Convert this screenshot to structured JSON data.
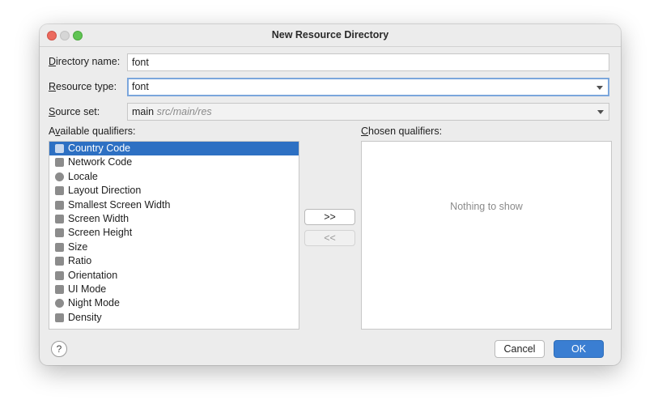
{
  "window": {
    "title": "New Resource Directory"
  },
  "form": {
    "directory_name": {
      "mnemonic": "D",
      "label_rest": "irectory name:",
      "value": "font"
    },
    "resource_type": {
      "mnemonic": "R",
      "label_rest": "esource type:",
      "value": "font"
    },
    "source_set": {
      "mnemonic": "S",
      "label_rest": "ource set:",
      "value": "main",
      "path": "src/main/res"
    }
  },
  "available": {
    "label_pre": "A",
    "mnemonic": "v",
    "label_rest": "ailable qualifiers:",
    "items": [
      {
        "label": "Country Code",
        "icon": "country-code-icon",
        "selected": true
      },
      {
        "label": "Network Code",
        "icon": "network-code-icon"
      },
      {
        "label": "Locale",
        "icon": "globe-icon"
      },
      {
        "label": "Layout Direction",
        "icon": "layout-direction-icon"
      },
      {
        "label": "Smallest Screen Width",
        "icon": "smallest-width-icon"
      },
      {
        "label": "Screen Width",
        "icon": "screen-width-icon"
      },
      {
        "label": "Screen Height",
        "icon": "screen-height-icon"
      },
      {
        "label": "Size",
        "icon": "size-icon"
      },
      {
        "label": "Ratio",
        "icon": "ratio-icon"
      },
      {
        "label": "Orientation",
        "icon": "orientation-icon"
      },
      {
        "label": "UI Mode",
        "icon": "ui-mode-icon"
      },
      {
        "label": "Night Mode",
        "icon": "night-mode-icon"
      },
      {
        "label": "Density",
        "icon": "density-icon"
      }
    ]
  },
  "chosen": {
    "mnemonic": "C",
    "label_rest": "hosen qualifiers:",
    "empty_text": "Nothing to show"
  },
  "buttons": {
    "add": ">>",
    "remove": "<<",
    "cancel": "Cancel",
    "ok": "OK",
    "help": "?"
  }
}
